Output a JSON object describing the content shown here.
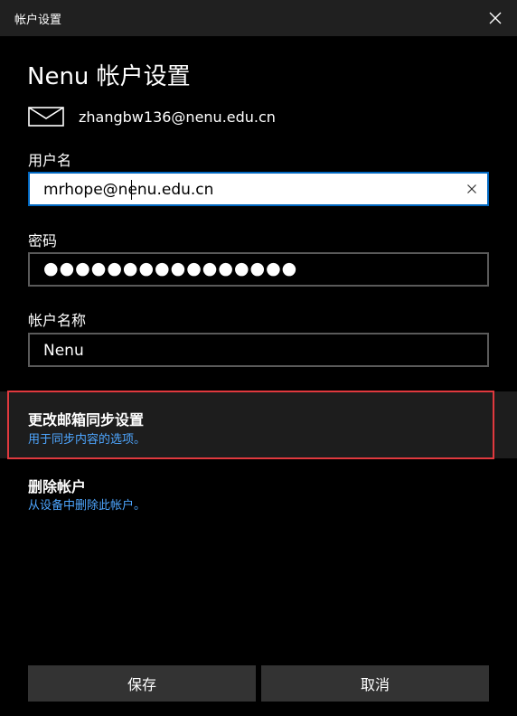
{
  "window": {
    "title": "帐户设置"
  },
  "page": {
    "title": "Nenu 帐户设置"
  },
  "account": {
    "email": "zhangbw136@nenu.edu.cn"
  },
  "fields": {
    "username": {
      "label": "用户名",
      "value": "mrhope@nenu.edu.cn"
    },
    "password": {
      "label": "密码",
      "value": "●●●●●●●●●●●●●●●●"
    },
    "account_name": {
      "label": "帐户名称",
      "value": "Nenu"
    }
  },
  "options": {
    "sync": {
      "title": "更改邮箱同步设置",
      "subtitle": "用于同步内容的选项。"
    },
    "delete": {
      "title": "删除帐户",
      "subtitle": "从设备中删除此帐户。"
    }
  },
  "buttons": {
    "save": "保存",
    "cancel": "取消"
  },
  "icons": {
    "mail": "mail-icon",
    "close": "close-icon",
    "clear": "clear-x-icon"
  },
  "colors": {
    "accent_border": "#0067c0",
    "link_text": "#4ea6ff",
    "highlight_outline": "#e0393e",
    "titlebar": "#202020",
    "button_bg": "#333333"
  }
}
